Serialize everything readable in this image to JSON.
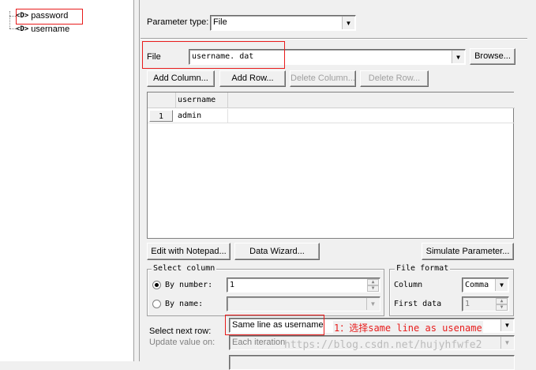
{
  "tree": {
    "items": [
      "password",
      "username"
    ],
    "icon_text": "<D>"
  },
  "param_type": {
    "label": "Parameter type:",
    "value": "File"
  },
  "file": {
    "label": "File",
    "value": "username. dat",
    "browse_label": "Browse..."
  },
  "toolbar": {
    "add_column": "Add Column...",
    "add_row": "Add Row...",
    "delete_column": "Delete Column...",
    "delete_row": "Delete Row..."
  },
  "table": {
    "headers": [
      "username"
    ],
    "rows": [
      {
        "num": "1",
        "cells": [
          "admin"
        ]
      }
    ]
  },
  "bottom_buttons": {
    "edit_notepad": "Edit with Notepad...",
    "data_wizard": "Data Wizard...",
    "simulate": "Simulate Parameter..."
  },
  "select_column": {
    "title": "Select column",
    "by_number_label": "By number:",
    "by_number_value": "1",
    "by_name_label": "By name:"
  },
  "file_format": {
    "title": "File format",
    "column_label": "Column",
    "column_value": "Comma",
    "first_data_label": "First data",
    "first_data_value": "1"
  },
  "select_next_row": {
    "label": "Select next row:",
    "value": "Same line as username"
  },
  "update_value": {
    "label": "Update value on:",
    "value": "Each iteration"
  },
  "annotation": "1：选择same line as usename",
  "watermark": "https://blog.csdn.net/hujyhfwfe2",
  "colors": {
    "annotation_red": "#e81c1c"
  }
}
